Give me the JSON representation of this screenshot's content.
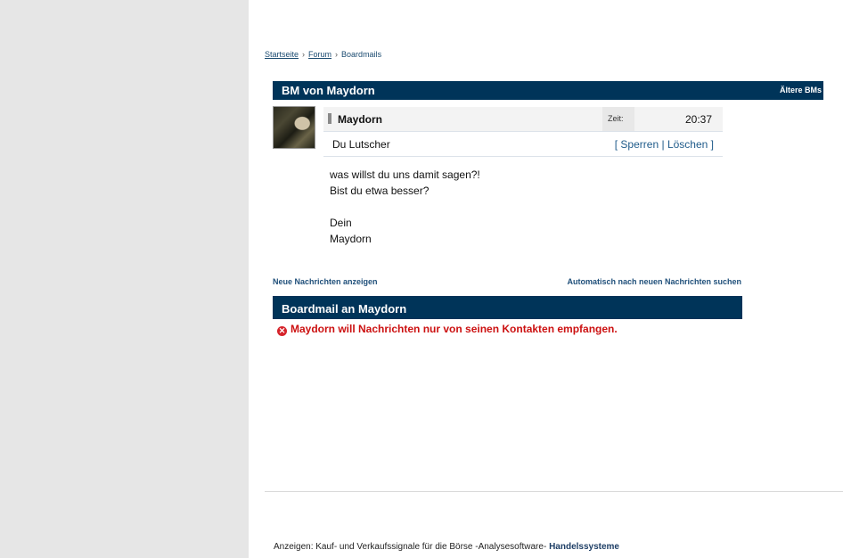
{
  "breadcrumb": {
    "items": [
      {
        "label": "Startseite"
      },
      {
        "label": "Forum"
      },
      {
        "label": "Boardmails"
      }
    ],
    "separator": "›"
  },
  "message": {
    "header_title": "BM von Maydorn",
    "older_link": "Ältere BMs",
    "sender": "Maydorn",
    "time_label": "Zeit:",
    "time_value": "20:37",
    "subject": "Du Lutscher",
    "actions": {
      "open_bracket": "[",
      "block": "Sperren",
      "pipe": "|",
      "delete": "Löschen",
      "close_bracket": "]"
    },
    "body_lines": [
      "was willst du uns damit sagen?!",
      "Bist du etwa besser?",
      "",
      "Dein",
      "Maydorn"
    ]
  },
  "links": {
    "show_new": "Neue Nachrichten anzeigen",
    "auto_search": "Automatisch nach neuen Nachrichten suchen"
  },
  "compose": {
    "header_title": "Boardmail an Maydorn",
    "error_text": "Maydorn will Nachrichten nur von seinen Kontakten empfangen.",
    "error_icon_glyph": "✕"
  },
  "ads": {
    "prefix": "Anzeigen: Kauf- und Verkaufssignale für die Börse -Analysesoftware-",
    "highlight": "Handelssysteme"
  },
  "colors": {
    "header_bg": "#003459",
    "error": "#cc1111",
    "link": "#1f4f7a",
    "sidebar_bg": "#e6e6e6"
  }
}
